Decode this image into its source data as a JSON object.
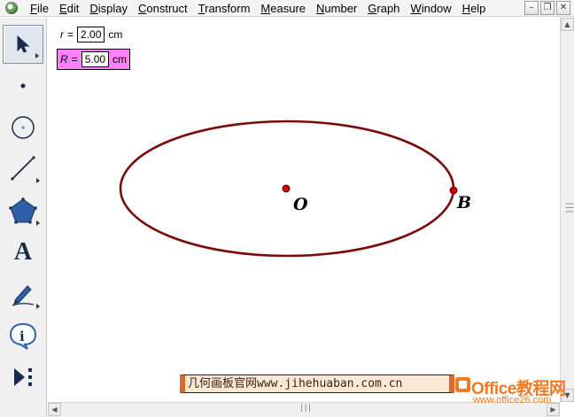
{
  "menubar": {
    "items": [
      "File",
      "Edit",
      "Display",
      "Construct",
      "Transform",
      "Measure",
      "Number",
      "Graph",
      "Window",
      "Help"
    ],
    "window_controls": [
      "–",
      "❐",
      "✕"
    ]
  },
  "toolbox": {
    "tools": [
      {
        "name": "arrow-tool-icon",
        "selected": true
      },
      {
        "name": "point-tool-icon"
      },
      {
        "name": "compass-tool-icon"
      },
      {
        "name": "straightedge-tool-icon"
      },
      {
        "name": "polygon-tool-icon"
      },
      {
        "name": "text-tool-icon",
        "glyph": "A"
      },
      {
        "name": "marker-tool-icon"
      },
      {
        "name": "information-tool-icon"
      },
      {
        "name": "custom-tool-icon"
      }
    ]
  },
  "parameters": {
    "r": {
      "name": "r",
      "eq": "=",
      "value": "2.00",
      "unit": "cm"
    },
    "R": {
      "name": "R",
      "eq": "=",
      "value": "5.00",
      "unit": "cm",
      "highlight": "#ff80ff"
    }
  },
  "sketch": {
    "ellipse_color": "#7a0a0a",
    "point_color": "#cc0000",
    "center_label": "O",
    "point_label": "B"
  },
  "watermark": {
    "text": "几何画板官网www.jihehuaban.com.cn"
  },
  "logo": {
    "text": "Office教程网",
    "url": "www.office26.com"
  },
  "scrollbars": {
    "grip": "|||"
  }
}
